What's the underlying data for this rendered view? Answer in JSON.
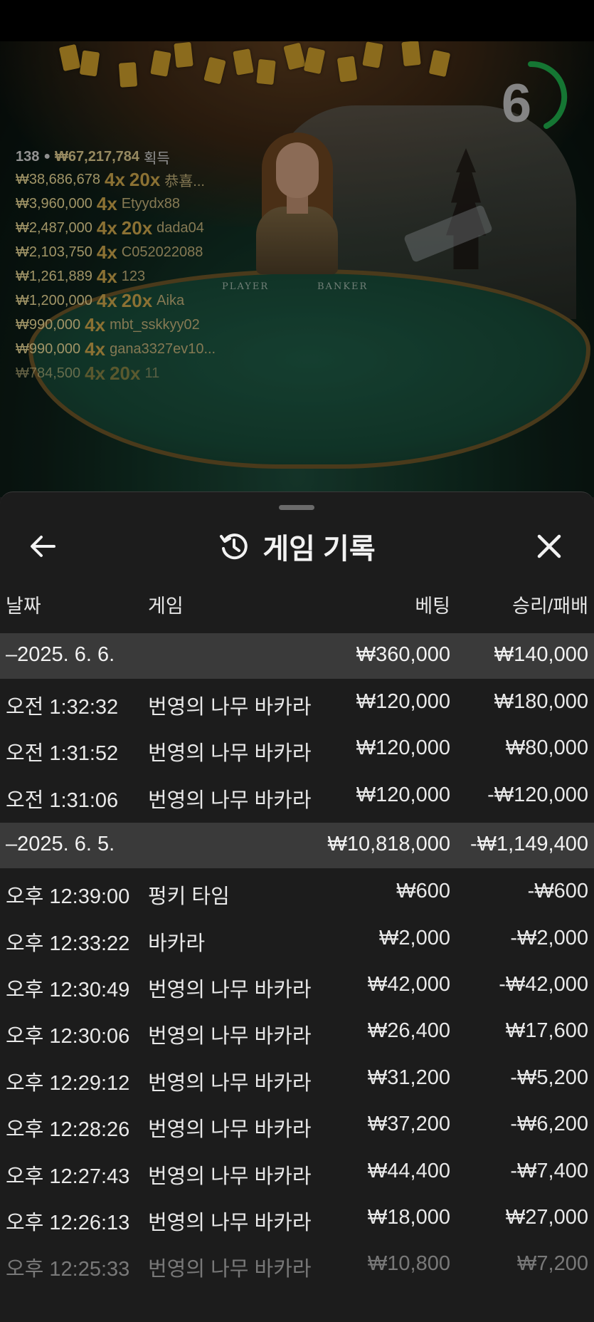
{
  "game": {
    "timer": "6",
    "timer_color": "#1faa4a",
    "summary": {
      "count": "138",
      "amount": "₩67,217,784",
      "label": "획득"
    },
    "winners": [
      {
        "amount": "₩38,686,678",
        "mult1": "4x",
        "mult2": "20x",
        "name": "恭喜..."
      },
      {
        "amount": "₩3,960,000",
        "mult1": "4x",
        "mult2": "",
        "name": "Etyydx88"
      },
      {
        "amount": "₩2,487,000",
        "mult1": "4x",
        "mult2": "20x",
        "name": "dada04"
      },
      {
        "amount": "₩2,103,750",
        "mult1": "4x",
        "mult2": "",
        "name": "C052022088"
      },
      {
        "amount": "₩1,261,889",
        "mult1": "4x",
        "mult2": "",
        "name": "123"
      },
      {
        "amount": "₩1,200,000",
        "mult1": "4x",
        "mult2": "20x",
        "name": "Aika"
      },
      {
        "amount": "₩990,000",
        "mult1": "4x",
        "mult2": "",
        "name": "mbt_sskkyy02"
      },
      {
        "amount": "₩990,000",
        "mult1": "4x",
        "mult2": "",
        "name": "gana3327ev10..."
      },
      {
        "amount": "₩784,500",
        "mult1": "4x",
        "mult2": "20x",
        "name": "11"
      }
    ],
    "table_labels": {
      "player": "PLAYER",
      "banker": "BANKER"
    }
  },
  "sheet": {
    "title": "게임 기록",
    "icons": {
      "back": "arrow-left-icon",
      "history": "history-icon",
      "close": "close-icon"
    },
    "columns": {
      "date": "날짜",
      "game": "게임",
      "bet": "베팅",
      "result": "승리/패배"
    },
    "groups": [
      {
        "date": "–2025. 6. 6.",
        "bet": "₩360,000",
        "result": "₩140,000",
        "rows": [
          {
            "time": "오전 1:32:32",
            "game": "번영의 나무 바카라",
            "bet": "₩120,000",
            "result": "₩180,000"
          },
          {
            "time": "오전 1:31:52",
            "game": "번영의 나무 바카라",
            "bet": "₩120,000",
            "result": "₩80,000"
          },
          {
            "time": "오전 1:31:06",
            "game": "번영의 나무 바카라",
            "bet": "₩120,000",
            "result": "-₩120,000"
          }
        ]
      },
      {
        "date": "–2025. 6. 5.",
        "bet": "₩10,818,000",
        "result": "-₩1,149,400",
        "rows": [
          {
            "time": "오후 12:39:00",
            "game": "펑키 타임",
            "bet": "₩600",
            "result": "-₩600"
          },
          {
            "time": "오후 12:33:22",
            "game": "바카라",
            "bet": "₩2,000",
            "result": "-₩2,000"
          },
          {
            "time": "오후 12:30:49",
            "game": "번영의 나무 바카라",
            "bet": "₩42,000",
            "result": "-₩42,000"
          },
          {
            "time": "오후 12:30:06",
            "game": "번영의 나무 바카라",
            "bet": "₩26,400",
            "result": "₩17,600"
          },
          {
            "time": "오후 12:29:12",
            "game": "번영의 나무 바카라",
            "bet": "₩31,200",
            "result": "-₩5,200"
          },
          {
            "time": "오후 12:28:26",
            "game": "번영의 나무 바카라",
            "bet": "₩37,200",
            "result": "-₩6,200"
          },
          {
            "time": "오후 12:27:43",
            "game": "번영의 나무 바카라",
            "bet": "₩44,400",
            "result": "-₩7,400"
          },
          {
            "time": "오후 12:26:13",
            "game": "번영의 나무 바카라",
            "bet": "₩18,000",
            "result": "₩27,000"
          },
          {
            "time": "오후 12:25:33",
            "game": "번영의 나무 바카라",
            "bet": "₩10,800",
            "result": "₩7,200"
          }
        ]
      }
    ]
  }
}
